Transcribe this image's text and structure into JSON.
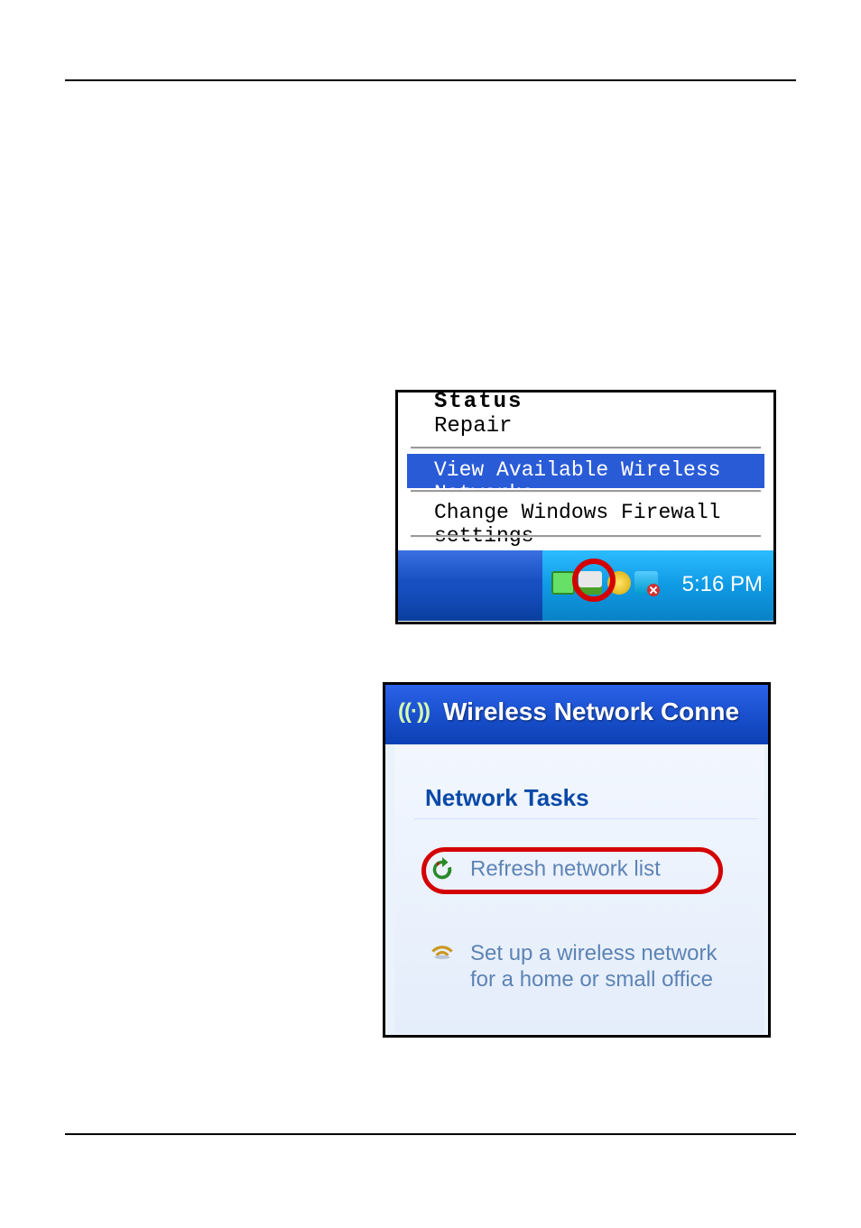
{
  "figure1": {
    "menu": {
      "status": "Status",
      "repair": "Repair",
      "view_available": "View Available Wireless Networks",
      "change_firewall": "Change Windows Firewall settings"
    },
    "tray": {
      "time": "5:16 PM",
      "icons": [
        "arrow-up-icon",
        "network-icon",
        "globe-icon",
        "monitor-icon"
      ]
    }
  },
  "figure2": {
    "title_icon": "((·))",
    "title": "Wireless Network Conne",
    "network_tasks_label": "Network Tasks",
    "tasks": {
      "refresh": "Refresh network list",
      "setup": "Set up a wireless network for a home or small office"
    }
  }
}
